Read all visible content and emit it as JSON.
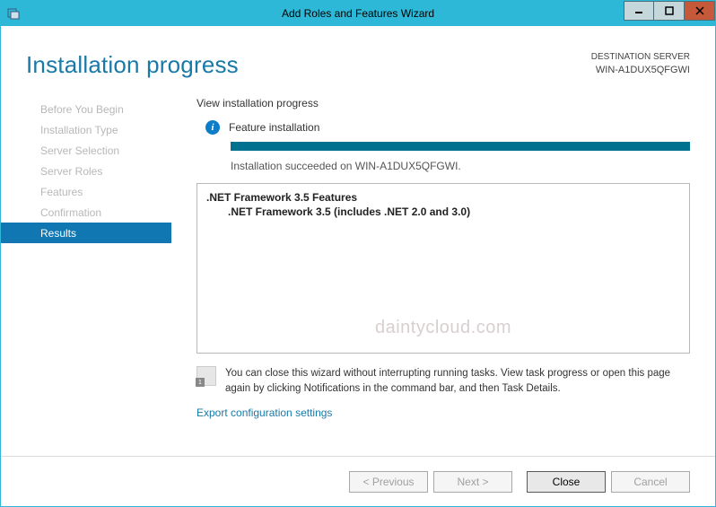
{
  "window": {
    "title": "Add Roles and Features Wizard"
  },
  "header": {
    "page_title": "Installation progress",
    "destination_label": "DESTINATION SERVER",
    "destination_name": "WIN-A1DUX5QFGWI"
  },
  "sidebar": {
    "items": [
      {
        "label": "Before You Begin"
      },
      {
        "label": "Installation Type"
      },
      {
        "label": "Server Selection"
      },
      {
        "label": "Server Roles"
      },
      {
        "label": "Features"
      },
      {
        "label": "Confirmation"
      },
      {
        "label": "Results"
      }
    ]
  },
  "main": {
    "subhead": "View installation progress",
    "status_text": "Feature installation",
    "succeeded_text": "Installation succeeded on WIN-A1DUX5QFGWI.",
    "features": {
      "parent": ".NET Framework 3.5 Features",
      "child": ".NET Framework 3.5 (includes .NET 2.0 and 3.0)"
    },
    "watermark": "daintycloud.com",
    "hint": "You can close this wizard without interrupting running tasks. View task progress or open this page again by clicking Notifications in the command bar, and then Task Details.",
    "export_link": "Export configuration settings"
  },
  "footer": {
    "previous": "< Previous",
    "next": "Next >",
    "close": "Close",
    "cancel": "Cancel"
  }
}
